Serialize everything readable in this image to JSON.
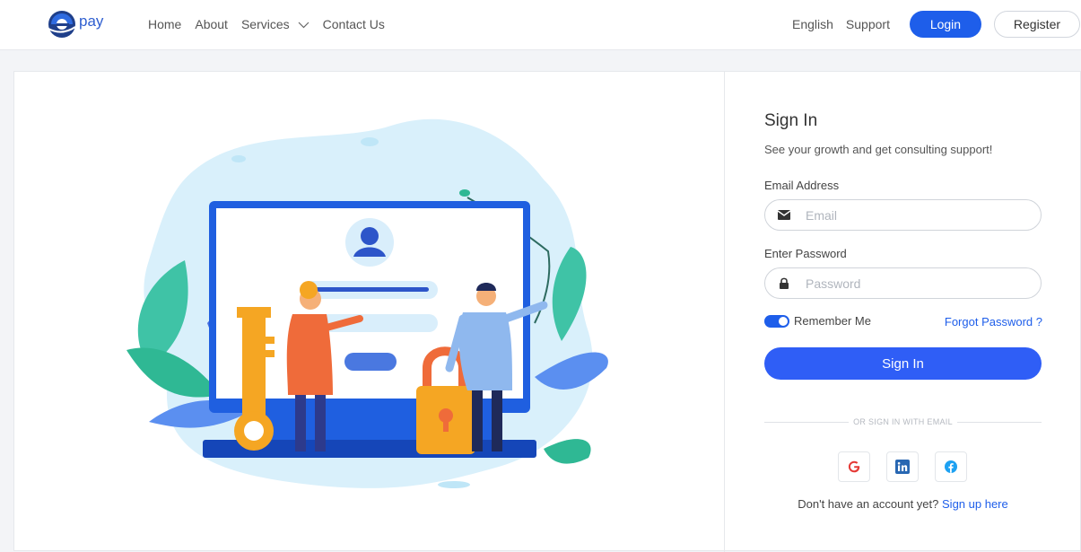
{
  "brand": {
    "logo_text": "pay"
  },
  "nav": {
    "home": "Home",
    "about": "About",
    "services": "Services",
    "contact": "Contact Us"
  },
  "right_nav": {
    "language": "English",
    "support": "Support",
    "login": "Login",
    "register": "Register"
  },
  "form": {
    "title": "Sign In",
    "subtitle": "See your growth and get consulting support!",
    "email_label": "Email Address",
    "email_placeholder": "Email",
    "password_label": "Enter Password",
    "password_placeholder": "Password",
    "remember_label": "Remember Me",
    "remember_checked": true,
    "forgot": "Forgot Password ?",
    "submit": "Sign In",
    "divider": "OR SIGN IN WITH EMAIL",
    "signup_prompt": "Don't have an account yet?",
    "signup_link": "Sign up here"
  },
  "colors": {
    "primary": "#1e5eea",
    "button": "#2f5ef6",
    "google": "#e53935",
    "linkedin": "#2867b2",
    "facebook": "#1da1f2"
  },
  "icons": [
    "chevron-down-icon",
    "envelope-icon",
    "lock-icon",
    "google-icon",
    "linkedin-icon",
    "facebook-icon"
  ]
}
